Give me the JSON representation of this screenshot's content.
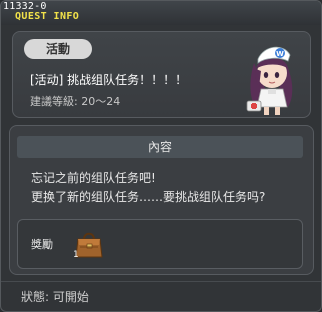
{
  "window": {
    "quest_id": "11332-0",
    "title": "QUEST INFO"
  },
  "quest": {
    "tag": "活動",
    "name": "[活动] 挑战组队任务！！！！",
    "level": "建議等級: 20～24",
    "npc_icon": "nurse-npc-icon"
  },
  "content": {
    "header": "內容",
    "lines": [
      "忘记之前的组队任务吧!",
      "更换了新的组队任务……要挑战组队任务吗?"
    ]
  },
  "reward": {
    "label": "獎勵",
    "item_icon": "bag-icon",
    "item_count": "1"
  },
  "status": {
    "text": "狀態: 可開始"
  },
  "colors": {
    "title": "#f2e24a",
    "background": "#313437",
    "panel": "#3b3e42",
    "content_header": "#4b5258"
  }
}
